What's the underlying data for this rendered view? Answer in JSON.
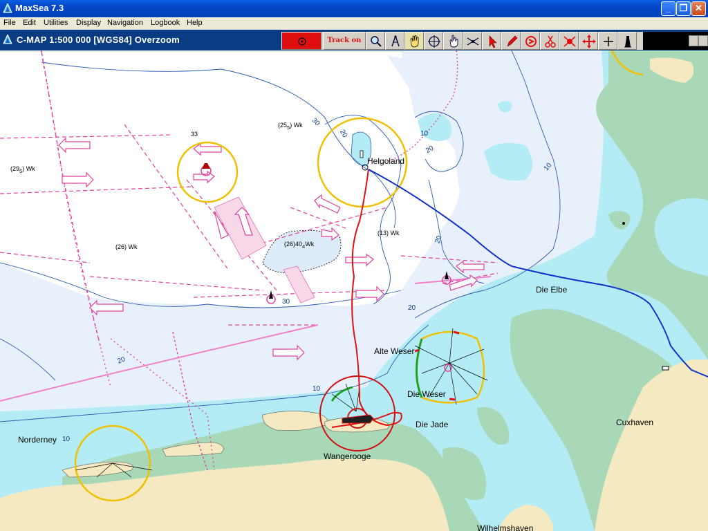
{
  "window": {
    "title": "MaxSea 7.3",
    "minimize_glyph": "_",
    "restore_glyph": "❐",
    "close_glyph": "✕"
  },
  "menu": [
    "File",
    "Edit",
    "Utilities",
    "Display",
    "Navigation",
    "Logbook",
    "Help"
  ],
  "chart_header": {
    "title": "C-MAP  1:500 000 [WGS84]    Overzoom"
  },
  "toolbar": {
    "track_label": "Track on",
    "tools": [
      "stop-icon",
      "track-toggle",
      "zoom-icon",
      "compass-icon",
      "hand-pan-icon",
      "crosshair-icon",
      "hand-point-icon",
      "measure-icon",
      "arrow-select-icon",
      "pencil-icon",
      "route-icon",
      "scissors-icon",
      "waypoint-icon",
      "move-icon",
      "plus-cursor-icon",
      "lighthouse-icon"
    ]
  },
  "map": {
    "place_names": {
      "helgoland": "Helgoland",
      "die_elbe": "Die Elbe",
      "alte_weser": "Alte Weser",
      "die_weser": "Die Weser",
      "die_jade": "Die Jade",
      "cuxhaven": "Cuxhaven",
      "norderney": "Norderney",
      "wangerooge": "Wangerooge",
      "wilhelmshaven": "Wilhelmshaven"
    },
    "depth_contours": {
      "c30a": "30",
      "c20a": "20",
      "c20b": "20",
      "c10a": "10",
      "c10b": "10",
      "c20c": "20",
      "c30b": "30",
      "c20d": "20",
      "c10c": "10",
      "c10d": "10",
      "c20e": "20"
    },
    "wrecks": {
      "w1": "25",
      "w1sub": "5",
      "w1tag": "Wk",
      "w2": "29",
      "w2sub": "5",
      "w2tag": "Wk",
      "w3": "26",
      "w3tag": "Wk",
      "w4": "26",
      "w4mid": "40",
      "w4sub": "4",
      "w4tag": "Wk",
      "w5": "13",
      "w5tag": "Wk",
      "sound_33": "33"
    },
    "colors": {
      "deep_water": "#ffffff",
      "medium_water": "#e8f0fb",
      "shallow_water": "#b4ecf6",
      "land": "#f4e9c0",
      "tidal_flat": "#a8d8b8",
      "route_red": "#e01010",
      "track_blue": "#1030d0",
      "traffic_magenta": "#e0409c",
      "light_ring": "#f0c000"
    }
  }
}
